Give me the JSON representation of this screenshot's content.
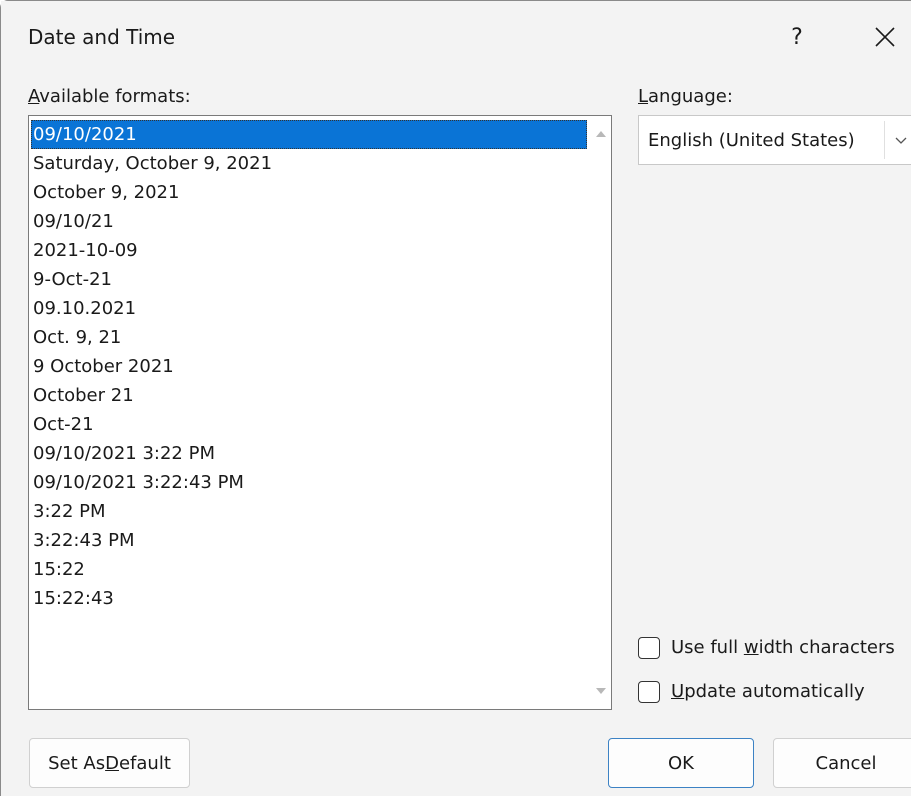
{
  "dialog": {
    "title": "Date and Time",
    "help_glyph": "?"
  },
  "formats": {
    "label_accel": "A",
    "label_rest": "vailable formats:",
    "selected_index": 0,
    "items": [
      "09/10/2021",
      "Saturday, October 9, 2021",
      "October 9, 2021",
      "09/10/21",
      "2021-10-09",
      "9-Oct-21",
      "09.10.2021",
      "Oct. 9, 21",
      "9 October 2021",
      "October 21",
      "Oct-21",
      "09/10/2021 3:22 PM",
      "09/10/2021 3:22:43 PM",
      "3:22 PM",
      "3:22:43 PM",
      "15:22",
      "15:22:43"
    ]
  },
  "language": {
    "label_accel": "L",
    "label_rest": "anguage:",
    "value": "English (United States)"
  },
  "options": {
    "full_width_pre": "Use full ",
    "full_width_accel": "w",
    "full_width_post": "idth characters",
    "full_width_checked": false,
    "auto_update_accel": "U",
    "auto_update_post": "pdate automatically",
    "auto_update_checked": false
  },
  "buttons": {
    "default_pre": "Set As ",
    "default_accel": "D",
    "default_post": "efault",
    "ok": "OK",
    "cancel": "Cancel"
  },
  "colors": {
    "selection": "#0a74d6",
    "dialog_bg": "#f3f3f3",
    "ok_border": "#3c82c4"
  },
  "icons": {
    "close": "close-icon",
    "dropdown": "chevron-down-icon",
    "scroll_up": "scroll-up-arrow-icon",
    "scroll_down": "scroll-down-arrow-icon"
  }
}
